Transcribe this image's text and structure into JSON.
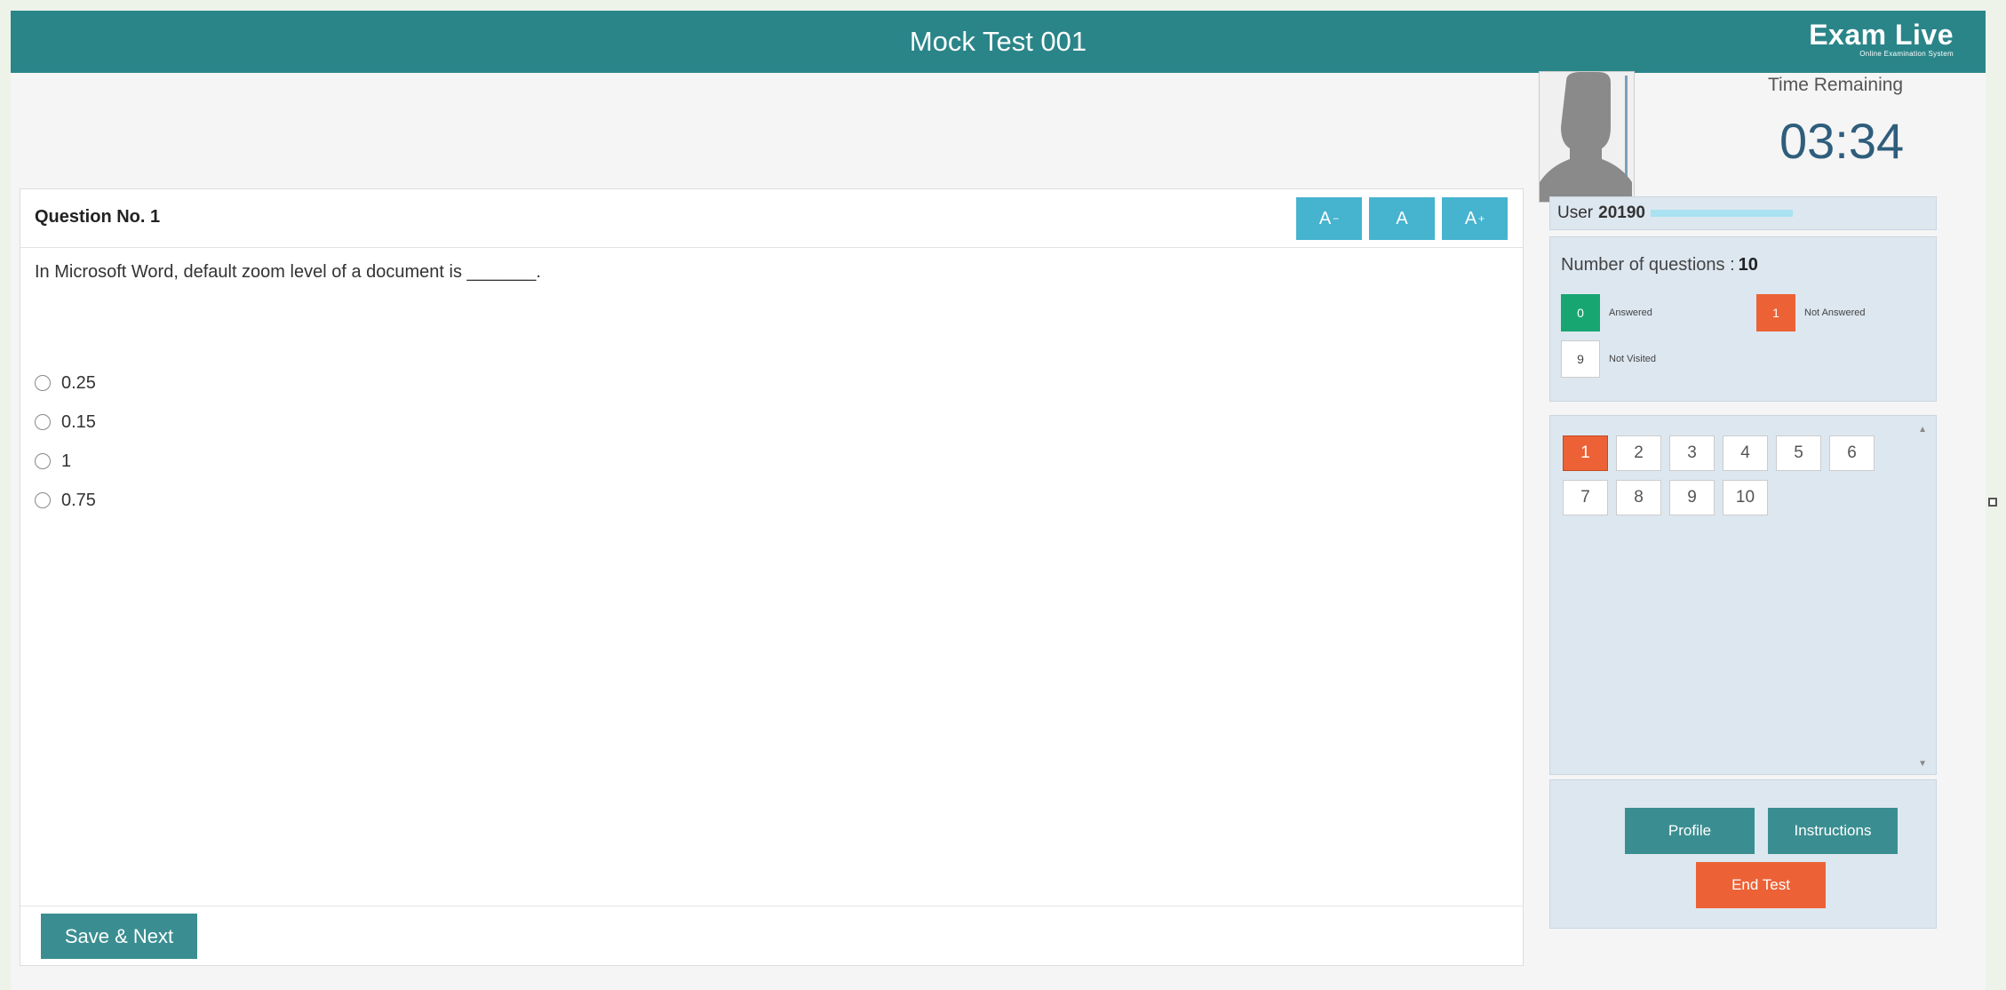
{
  "header": {
    "title": "Mock Test 001",
    "logo_main": "Exam Live",
    "logo_sub": "Online Examination System"
  },
  "question": {
    "number_label": "Question No. 1",
    "text": "In Microsoft Word, default zoom level of a document is _______.",
    "options": [
      "0.25",
      "0.15",
      "1",
      "0.75"
    ]
  },
  "font_controls": {
    "decrease": "A",
    "normal": "A",
    "increase": "A"
  },
  "footer": {
    "save_next": "Save & Next"
  },
  "timer": {
    "label": "Time Remaining",
    "value": "03:34"
  },
  "user": {
    "label": "User",
    "id_prefix": "20190"
  },
  "summary": {
    "number_label": "Number of questions :",
    "number_value": "10",
    "answered_count": "0",
    "answered_label": "Answered",
    "not_answered_count": "1",
    "not_answered_label": "Not Answered",
    "not_visited_count": "9",
    "not_visited_label": "Not Visited"
  },
  "palette": {
    "questions": [
      "1",
      "2",
      "3",
      "4",
      "5",
      "6",
      "7",
      "8",
      "9",
      "10"
    ],
    "current": "1"
  },
  "actions": {
    "profile": "Profile",
    "instructions": "Instructions",
    "end_test": "End Test"
  },
  "colors": {
    "header": "#2a8589",
    "answered": "#17a672",
    "not_answered": "#ec6236",
    "font_button": "#46b3cf"
  }
}
